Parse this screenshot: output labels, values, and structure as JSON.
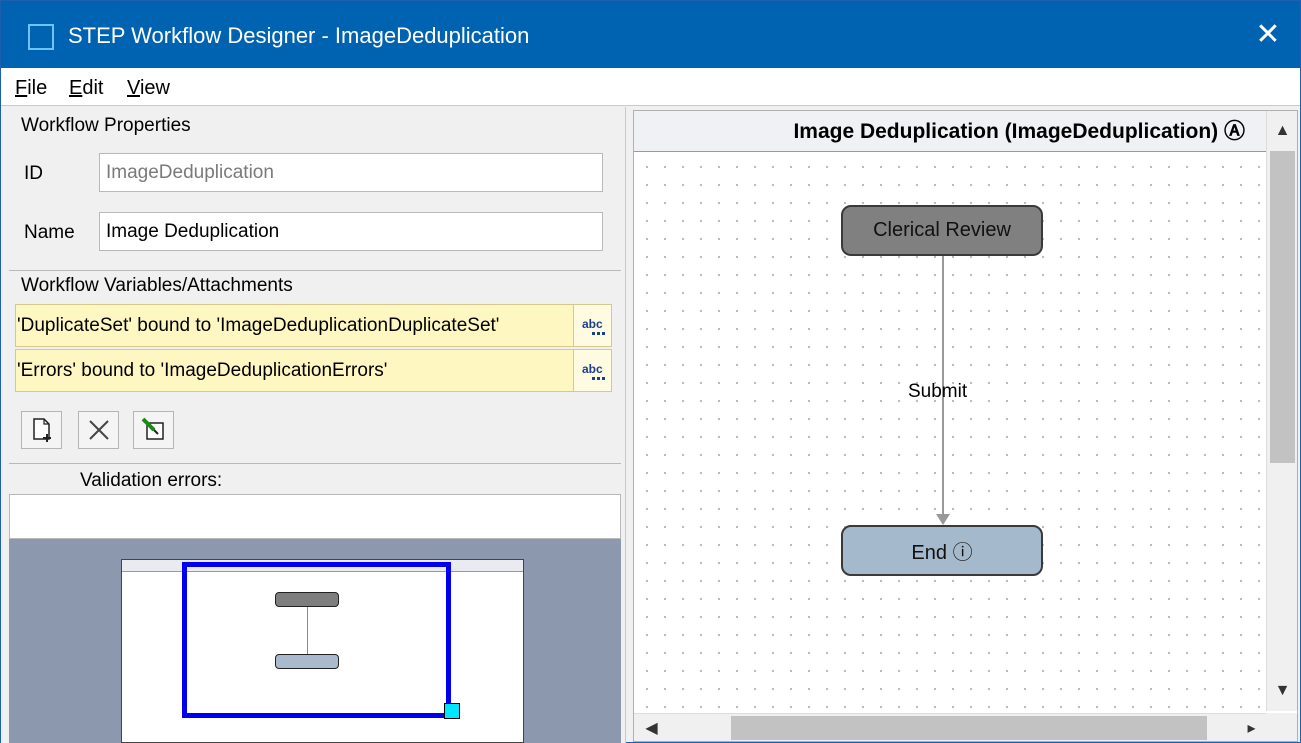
{
  "window": {
    "title": "STEP Workflow Designer - ImageDeduplication",
    "close_label": "✕"
  },
  "menu": {
    "file": "File",
    "edit": "Edit",
    "view": "View"
  },
  "properties": {
    "section_title": "Workflow Properties",
    "id_label": "ID",
    "id_value": "ImageDeduplication",
    "name_label": "Name",
    "name_value": "Image Deduplication"
  },
  "variables": {
    "section_title": "Workflow Variables/Attachments",
    "items": [
      {
        "label": "'DuplicateSet' bound to 'ImageDeduplicationDuplicateSet'",
        "icon": "abc-edit-icon"
      },
      {
        "label": "'Errors' bound to 'ImageDeduplicationErrors'",
        "icon": "abc-edit-icon"
      }
    ],
    "toolbar": {
      "add_icon": "add-document-icon",
      "delete_icon": "delete-x-icon",
      "edit_icon": "edit-pencil-icon"
    }
  },
  "validation": {
    "label": "Validation errors:",
    "value": ""
  },
  "canvas": {
    "title": "Image Deduplication (ImageDeduplication) Ⓐ",
    "nodes": {
      "review": "Clerical Review",
      "end": "End ⓘ"
    },
    "edge_label": "Submit",
    "colors": {
      "review_fill": "#808080",
      "end_fill": "#a5b9cd",
      "viewport_border": "#0000ee",
      "title_bar": "#0063b1"
    }
  },
  "scroll": {
    "up": "▲",
    "down": "▼",
    "left": "◀",
    "right": "▸"
  }
}
